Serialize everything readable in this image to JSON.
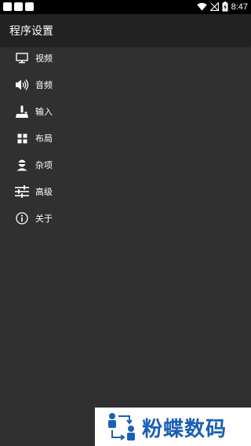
{
  "status_bar": {
    "time": "8:47",
    "icons": [
      "notification-box-icon",
      "notification-box-icon",
      "notification-box-icon",
      "wifi-icon",
      "signal-icon",
      "battery-charging-icon"
    ]
  },
  "app_bar": {
    "title": "程序设置"
  },
  "menu": {
    "items": [
      {
        "label": "视频",
        "icon": "monitor-icon"
      },
      {
        "label": "音频",
        "icon": "speaker-icon"
      },
      {
        "label": "输入",
        "icon": "joystick-icon"
      },
      {
        "label": "布局",
        "icon": "grid-icon"
      },
      {
        "label": "杂项",
        "icon": "person-icon"
      },
      {
        "label": "高级",
        "icon": "sliders-icon"
      },
      {
        "label": "关于",
        "icon": "info-icon"
      }
    ]
  },
  "watermark": {
    "text": "粉蝶数码",
    "color": "#1a5fb4"
  },
  "colors": {
    "background": "#303030",
    "app_bar": "#222222",
    "status_bar": "#000000"
  }
}
